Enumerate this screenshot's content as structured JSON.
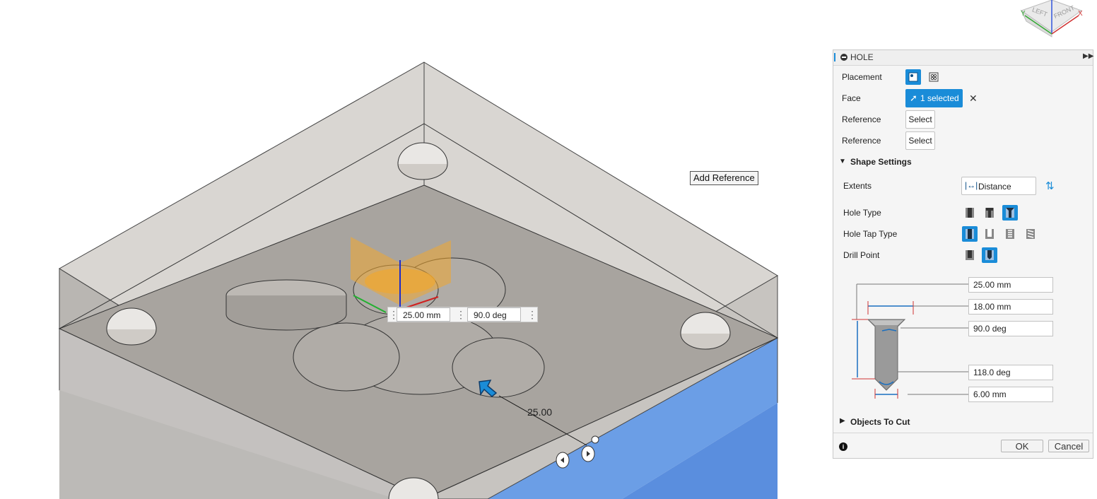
{
  "viewport": {
    "add_reference_label": "Add Reference",
    "depth_value": "25.00 mm",
    "angle_value": "90.0 deg",
    "distance_label": "25.00",
    "viewcube": {
      "left_label": "LEFT",
      "front_label": "FRONT",
      "x_label": "X",
      "y_label": "Y"
    }
  },
  "panel": {
    "title": "HOLE",
    "placement_label": "Placement",
    "face_label": "Face",
    "face_selected": "1 selected",
    "reference1_label": "Reference",
    "reference1_button": "Select",
    "reference2_label": "Reference",
    "reference2_button": "Select",
    "shape_settings_label": "Shape Settings",
    "extents_label": "Extents",
    "extents_value": "Distance",
    "hole_type_label": "Hole Type",
    "hole_tap_type_label": "Hole Tap Type",
    "drill_point_label": "Drill Point",
    "dims": {
      "depth": "25.00 mm",
      "cbore_diameter": "18.00 mm",
      "cbore_angle": "90.0 deg",
      "drill_point_angle": "118.0 deg",
      "hole_diameter": "6.00 mm"
    },
    "objects_to_cut_label": "Objects To Cut",
    "ok_label": "OK",
    "cancel_label": "Cancel"
  },
  "colors": {
    "accent": "#1a8cd8",
    "face_highlight": "#6b9ee6",
    "preview_orange": "#f0a830"
  }
}
